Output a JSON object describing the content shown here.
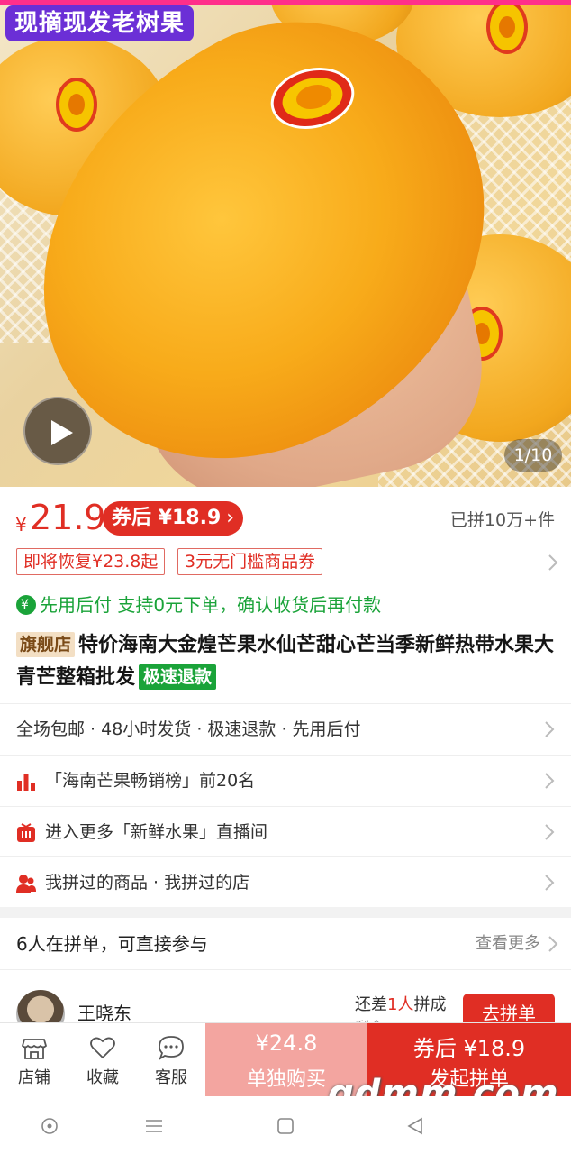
{
  "hero": {
    "banner": "现摘现发老树果",
    "counter": "1/10"
  },
  "price": {
    "yen": "¥",
    "value": "21.9",
    "coupon_label": "券后 ¥18.9",
    "sold": "已拼10万+件"
  },
  "tags": [
    "即将恢复¥23.8起",
    "3元无门槛商品券"
  ],
  "pay_later": "先用后付  支持0元下单，确认收货后再付款",
  "title": {
    "flag": "旗舰店",
    "text": "特价海南大金煌芒果水仙芒甜心芒当季新鲜热带水果大青芒整箱批发",
    "refund": "极速退款"
  },
  "info": [
    "全场包邮 · 48小时发货 · 极速退款 · 先用后付",
    "「海南芒果畅销榜」前20名",
    "进入更多「新鲜水果」直播间",
    "我拼过的商品 · 我拼过的店"
  ],
  "group": {
    "title": "6人在拼单，可直接参与",
    "more": "查看更多",
    "user_name": "王晓东",
    "need_prefix": "还差",
    "need_count": "1人",
    "need_suffix": "拼成",
    "remain": "剩余",
    "join": "去拼单"
  },
  "bottom": {
    "store": "店铺",
    "fav": "收藏",
    "service": "客服",
    "alone_price": "¥24.8",
    "alone_label": "单独购买",
    "group_price": "券后 ¥18.9",
    "group_label": "发起拼单"
  },
  "watermark": "gdmm.com",
  "colors": {
    "accent": "#e02e24",
    "green": "#1aa339",
    "banner": "#6b2fd6"
  }
}
